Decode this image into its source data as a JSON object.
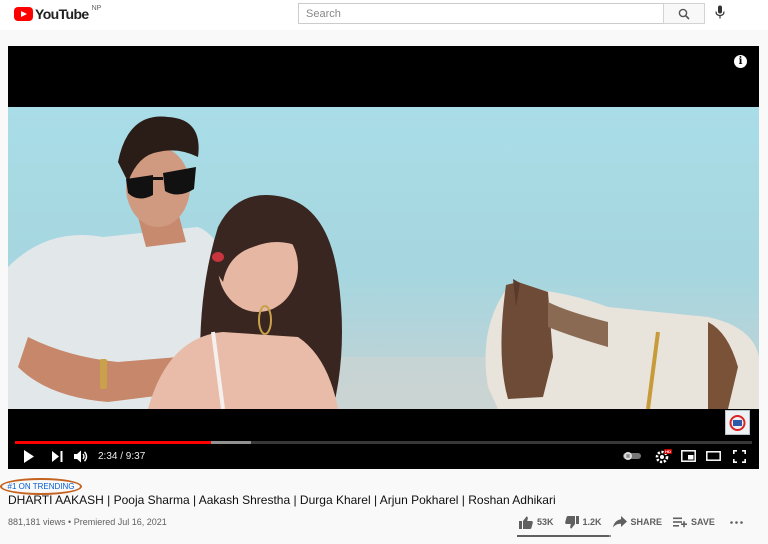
{
  "header": {
    "logo_text": "YouTube",
    "country": "NP",
    "search_placeholder": "Search"
  },
  "player": {
    "current_time": "2:34",
    "duration": "9:37",
    "time_text": "2:34 / 9:37",
    "progress_played": 0.266,
    "progress_buffered": 0.32,
    "info_label": "i",
    "hd_badge": "HD"
  },
  "video": {
    "trending": "#1 ON TRENDING",
    "title": "DHARTI AAKASH | Pooja Sharma | Aakash Shrestha | Durga Kharel | Arjun Pokharel | Roshan Adhikari",
    "views": "881,181 views",
    "premiered": "Premiered Jul 16, 2021",
    "meta_text": "881,181 views • Premiered Jul 16, 2021"
  },
  "actions": {
    "likes": "53K",
    "dislikes": "1.2K",
    "share": "SHARE",
    "save": "SAVE",
    "like_ratio": 0.978
  },
  "icons": [
    "search-icon",
    "mic-icon",
    "info-icon",
    "play-icon",
    "next-icon",
    "volume-icon",
    "autoplay-toggle",
    "settings-icon",
    "miniplayer-icon",
    "theater-icon",
    "fullscreen-icon",
    "thumbs-up-icon",
    "thumbs-down-icon",
    "share-icon",
    "save-icon",
    "more-icon"
  ],
  "colors": {
    "brand_red": "#ff0000",
    "link_blue": "#065fd4",
    "annotation_orange": "#c4621f"
  }
}
